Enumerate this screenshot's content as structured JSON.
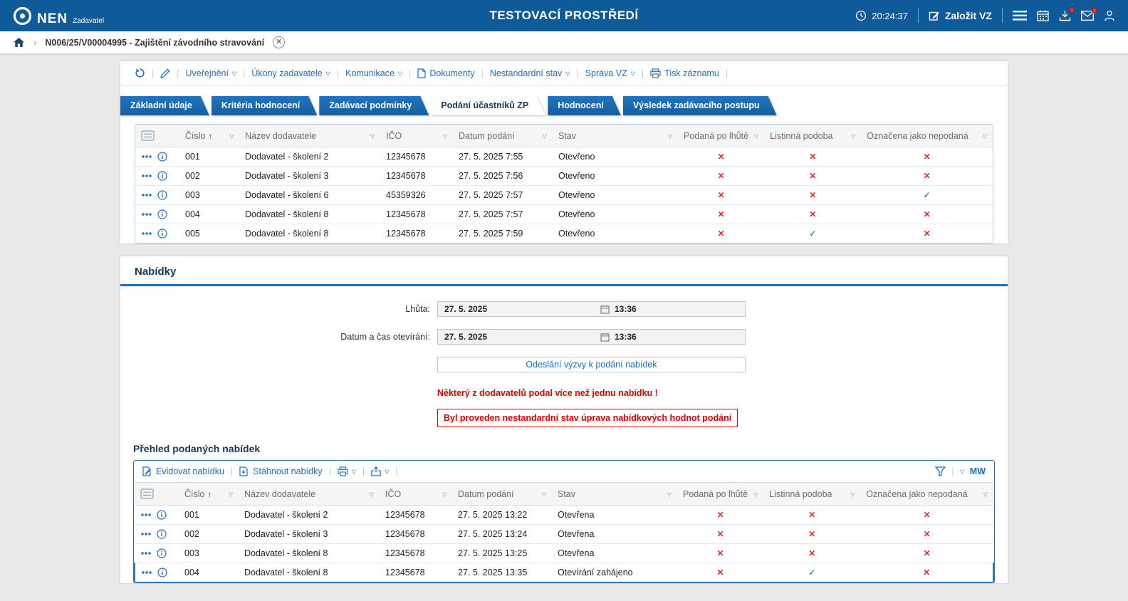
{
  "header": {
    "brand": "NEN",
    "brand_sub": "Zadavatel",
    "env_title": "TESTOVACÍ PROSTŘEDÍ",
    "time": "20:24:37",
    "create_vz_label": "Založit VZ"
  },
  "breadcrumb": {
    "record": "N006/25/V00004995 - Zajištění závodního stravování"
  },
  "toolbar": {
    "items": [
      {
        "label": "Uveřejnění"
      },
      {
        "label": "Úkony zadavatele"
      },
      {
        "label": "Komunikace"
      },
      {
        "label": "Dokumenty"
      },
      {
        "label": "Nestandardní stav"
      },
      {
        "label": "Správa VZ"
      },
      {
        "label": "Tisk záznamu"
      }
    ]
  },
  "tabs": [
    {
      "label": "Základní údaje"
    },
    {
      "label": "Kritéria hodnocení"
    },
    {
      "label": "Zadávací podmínky"
    },
    {
      "label": "Podání účastníků ZP",
      "_class": "active"
    },
    {
      "label": "Hodnocení"
    },
    {
      "label": "Výsledek zadávacího postupu"
    }
  ],
  "table_headers": [
    {
      "label": "Číslo",
      "sort": "↑"
    },
    {
      "label": "Název dodavatele",
      "sort": ""
    },
    {
      "label": "IČO",
      "sort": ""
    },
    {
      "label": "Datum podání",
      "sort": ""
    },
    {
      "label": "Stav",
      "sort": ""
    },
    {
      "label": "Podaná po lhůtě",
      "sort": ""
    },
    {
      "label": "Listinná podoba",
      "sort": ""
    },
    {
      "label": "Označena jako nepodaná",
      "sort": ""
    }
  ],
  "participations": {
    "rows": [
      {
        "cislo": "001",
        "dodavatel": "Dodavatel - školení 2",
        "ico": "12345678",
        "datum": "27. 5. 2025 7:55",
        "stav": "Otevřeno",
        "po_lhute": "✕",
        "listinna": "✕",
        "nepodana": "✕"
      },
      {
        "cislo": "002",
        "dodavatel": "Dodavatel - školení 3",
        "ico": "12345678",
        "datum": "27. 5. 2025 7:56",
        "stav": "Otevřeno",
        "po_lhute": "✕",
        "listinna": "✕",
        "nepodana": "✕"
      },
      {
        "cislo": "003",
        "dodavatel": "Dodavatel - školení 6",
        "ico": "45359326",
        "datum": "27. 5. 2025 7:57",
        "stav": "Otevřeno",
        "po_lhute": "✕",
        "listinna": "✕",
        "nepodana": "✓"
      },
      {
        "cislo": "004",
        "dodavatel": "Dodavatel - školení 8",
        "ico": "12345678",
        "datum": "27. 5. 2025 7:57",
        "stav": "Otevřeno",
        "po_lhute": "✕",
        "listinna": "✕",
        "nepodana": "✕"
      },
      {
        "cislo": "005",
        "dodavatel": "Dodavatel - školení 8",
        "ico": "12345678",
        "datum": "27. 5. 2025 7:59",
        "stav": "Otevřeno",
        "po_lhute": "✕",
        "listinna": "✓",
        "nepodana": "✕"
      }
    ]
  },
  "offers": {
    "section_title": "Nabídky",
    "deadline_label": "Lhůta:",
    "deadline_date": "27. 5. 2025",
    "deadline_time": "13:36",
    "opening_label": "Datum a čas otevírání:",
    "opening_date": "27. 5. 2025",
    "opening_time": "13:36",
    "send_call_label": "Odeslání výzvy k podání nabídek",
    "warning_multiple": "Některý z dodavatelů podal více než jednu nabídku !",
    "warning_nonstandard": "Byl proveden nestandardní stav úprava nabídkových hodnot podání",
    "overview_title": "Přehled podaných nabídek",
    "toolbar": {
      "register_label": "Evidovat nabídku",
      "download_label": "Stáhnout nabídky",
      "mw_label": "MW"
    },
    "rows": [
      {
        "cislo": "001",
        "dodavatel": "Dodavatel - školení 2",
        "ico": "12345678",
        "datum": "27. 5. 2025 13:22",
        "stav": "Otevřena",
        "po_lhute": "✕",
        "listinna": "✕",
        "nepodana": "✕"
      },
      {
        "cislo": "002",
        "dodavatel": "Dodavatel - školení 3",
        "ico": "12345678",
        "datum": "27. 5. 2025 13:24",
        "stav": "Otevřena",
        "po_lhute": "✕",
        "listinna": "✕",
        "nepodana": "✕"
      },
      {
        "cislo": "003",
        "dodavatel": "Dodavatel - školení 8",
        "ico": "12345678",
        "datum": "27. 5. 2025 13:25",
        "stav": "Otevřena",
        "po_lhute": "✕",
        "listinna": "✕",
        "nepodana": "✕"
      },
      {
        "cislo": "004",
        "dodavatel": "Dodavatel - školení 8",
        "ico": "12345678",
        "datum": "27. 5. 2025 13:35",
        "stav": "Otevírání zahájeno",
        "po_lhute": "✕",
        "listinna": "✓",
        "nepodana": "✕",
        "_class": "row-selected"
      }
    ]
  }
}
